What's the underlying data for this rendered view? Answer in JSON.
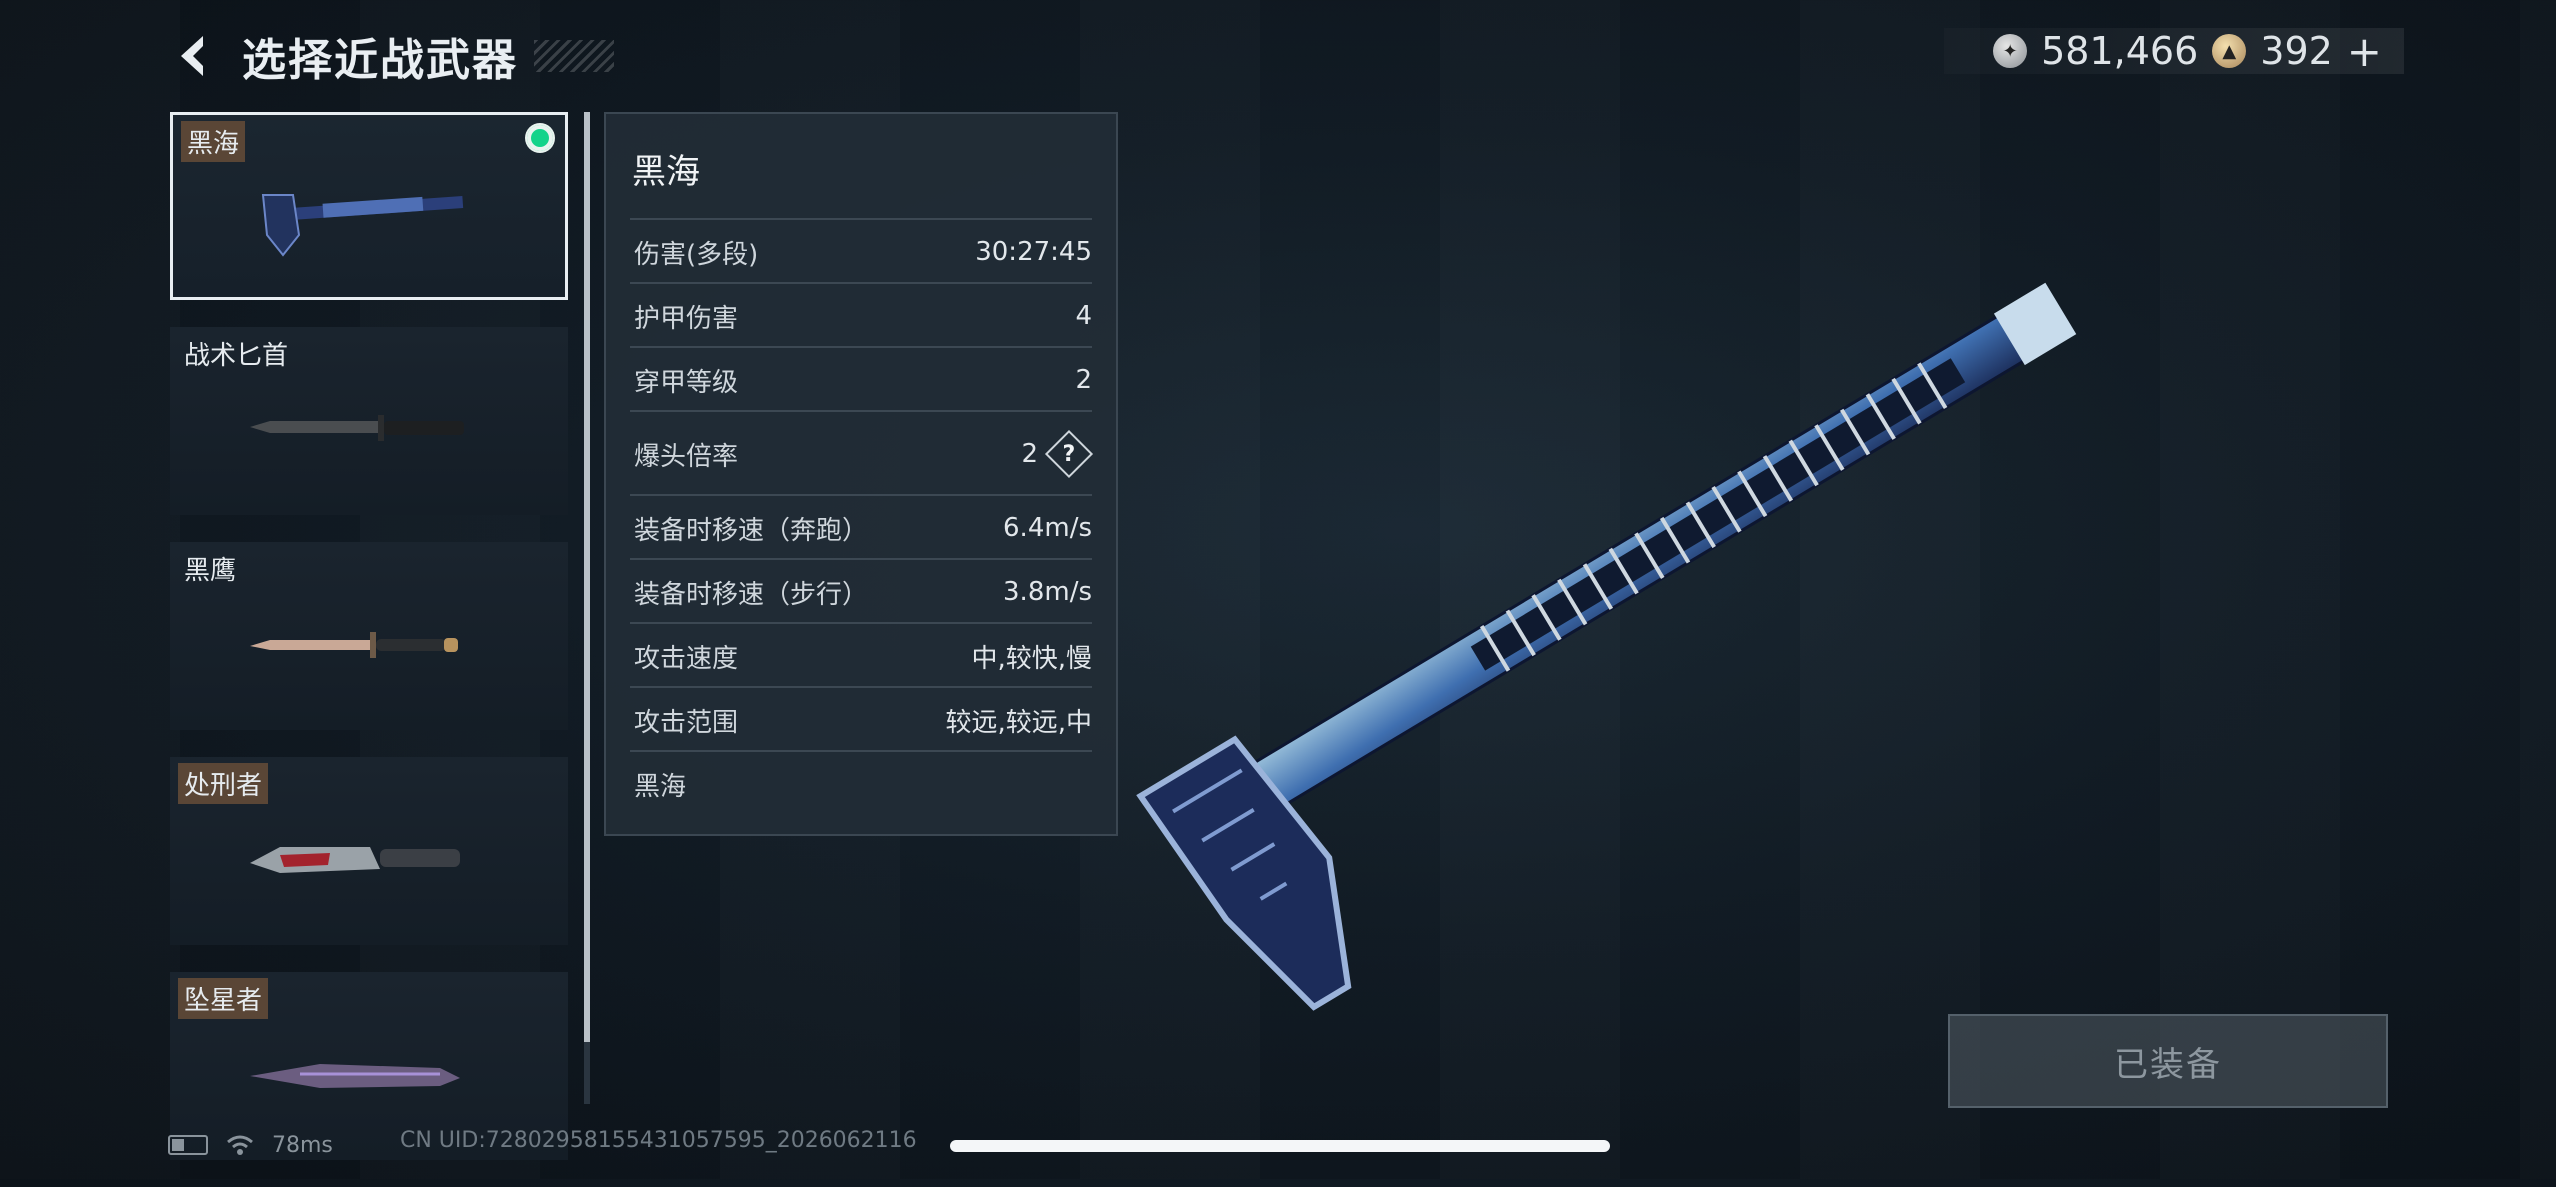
{
  "header": {
    "title": "选择近战武器"
  },
  "currency": {
    "silver": "581,466",
    "gold": "392",
    "plus": "+"
  },
  "weapons": [
    {
      "name": "黑海",
      "selected": true,
      "equipped": true,
      "tagged": true
    },
    {
      "name": "战术匕首",
      "selected": false,
      "tagged": false
    },
    {
      "name": "黑鹰",
      "selected": false,
      "tagged": false
    },
    {
      "name": "处刑者",
      "selected": false,
      "tagged": true
    },
    {
      "name": "坠星者",
      "selected": false,
      "tagged": true
    }
  ],
  "stats": {
    "title": "黑海",
    "rows": [
      {
        "label": "伤害(多段)",
        "value": "30:27:45"
      },
      {
        "label": "护甲伤害",
        "value": "4"
      },
      {
        "label": "穿甲等级",
        "value": "2"
      },
      {
        "label": "爆头倍率",
        "value": "2",
        "help": "?"
      },
      {
        "label": "装备时移速（奔跑）",
        "value": "6.4m/s"
      },
      {
        "label": "装备时移速（步行）",
        "value": "3.8m/s"
      },
      {
        "label": "攻击速度",
        "value": "中,较快,慢"
      },
      {
        "label": "攻击范围",
        "value": "较远,较远,中"
      },
      {
        "label": "黑海",
        "value": ""
      }
    ]
  },
  "equip_button": "已装备",
  "status": {
    "ping": "78ms",
    "uid": "CN UID:72802958155431057595_2026062116"
  },
  "colors": {
    "equipped": "#13d38a",
    "tag_bg": "#5a4636",
    "panel": "#222c36"
  }
}
